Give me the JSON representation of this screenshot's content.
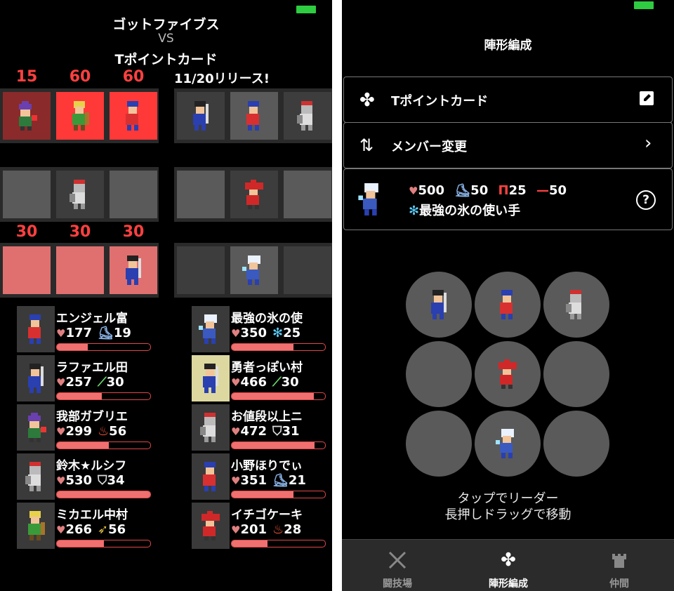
{
  "left": {
    "title_line1": "ゴットファイブス",
    "title_vs": "VS",
    "title_line2": "Tポイントカード",
    "release": "11/20リリース!",
    "row1_numbers": [
      "15",
      "60",
      "60"
    ],
    "row3_numbers": [
      "30",
      "30",
      "30"
    ],
    "members_left": [
      {
        "name": "エンジェル富",
        "hp": "177",
        "stat": "19",
        "stat_icon": "boot-icon",
        "hp_ratio": 0.33
      },
      {
        "name": "ラファエル田",
        "hp": "257",
        "stat": "30",
        "stat_icon": "sword-icon",
        "hp_ratio": 0.48
      },
      {
        "name": "我部ガブリエ",
        "hp": "299",
        "stat": "56",
        "stat_icon": "fire-icon",
        "hp_ratio": 0.56
      },
      {
        "name": "鈴木★ルシフ",
        "hp": "530",
        "stat": "34",
        "stat_icon": "shield-icon",
        "hp_ratio": 1.0
      },
      {
        "name": "ミカエル中村",
        "hp": "266",
        "stat": "56",
        "stat_icon": "arrow-icon",
        "hp_ratio": 0.5
      }
    ],
    "members_right": [
      {
        "name": "最強の氷の使",
        "hp": "350",
        "stat": "25",
        "stat_icon": "ice-icon",
        "hp_ratio": 0.66
      },
      {
        "name": "勇者っぽい村",
        "hp": "466",
        "stat": "30",
        "stat_icon": "sword-icon",
        "hp_ratio": 0.88
      },
      {
        "name": "お値段以上ニ",
        "hp": "472",
        "stat": "31",
        "stat_icon": "shield-icon",
        "hp_ratio": 0.89
      },
      {
        "name": "小野ほりでぃ",
        "hp": "351",
        "stat": "21",
        "stat_icon": "boot-icon",
        "hp_ratio": 0.66
      },
      {
        "name": "イチゴケーキ",
        "hp": "201",
        "stat": "28",
        "stat_icon": "fire-icon",
        "hp_ratio": 0.38
      }
    ]
  },
  "right": {
    "header_title": "陣形編成",
    "team_name": "Tポイントカード",
    "member_change": "メンバー変更",
    "leader": {
      "hp": "500",
      "speed": "50",
      "attack": "25",
      "range": "50",
      "title": "最強の氷の使い手"
    },
    "hint_line1": "タップでリーダー",
    "hint_line2": "長押しドラッグで移動"
  },
  "tabs": [
    {
      "label": "闘技場",
      "icon": "crossed-swords-icon"
    },
    {
      "label": "陣形編成",
      "icon": "formation-icon"
    },
    {
      "label": "仲間",
      "icon": "castle-icon"
    }
  ],
  "colors": {
    "accent_red": "#ff4040",
    "battery": "#2ecc40",
    "hp_bar": "#f07070"
  }
}
